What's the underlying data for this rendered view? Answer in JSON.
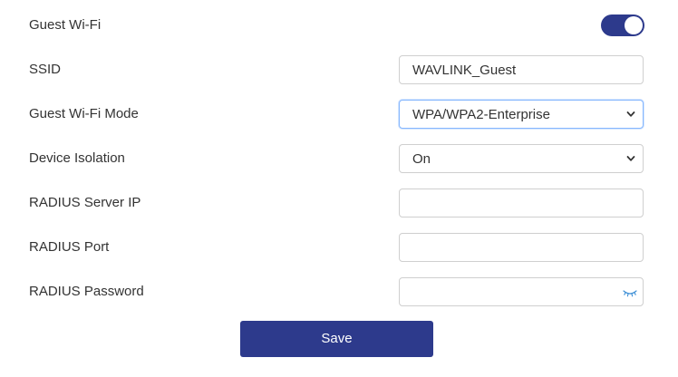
{
  "colors": {
    "accent": "#2d3a8c",
    "border": "#cfcfcf",
    "focus_border": "#86b7fe",
    "eye_icon": "#3d8fd6"
  },
  "guest_wifi": {
    "label": "Guest Wi-Fi",
    "enabled": true
  },
  "ssid": {
    "label": "SSID",
    "value": "WAVLINK_Guest"
  },
  "mode": {
    "label": "Guest Wi-Fi Mode",
    "selected": "WPA/WPA2-Enterprise"
  },
  "isolation": {
    "label": "Device Isolation",
    "selected": "On"
  },
  "radius_ip": {
    "label": "RADIUS Server IP",
    "value": ""
  },
  "radius_port": {
    "label": "RADIUS Port",
    "value": ""
  },
  "radius_password": {
    "label": "RADIUS Password",
    "value": "",
    "visibility_icon": "eye-closed-icon"
  },
  "save_label": "Save"
}
